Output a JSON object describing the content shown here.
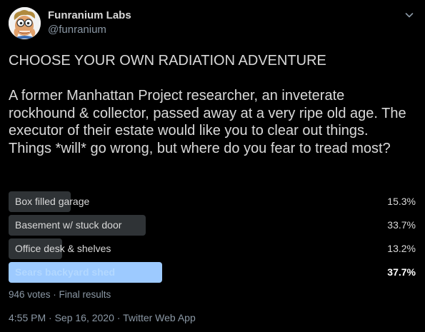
{
  "author": {
    "display_name": "Funranium Labs",
    "handle": "@funranium",
    "avatar_icon": "cartoon-scientist-avatar"
  },
  "tweet": {
    "text": "CHOOSE YOUR OWN RADIATION ADVENTURE\n\nA former Manhattan Project researcher, an inveterate rockhound & collector, passed away at a very ripe old age. The executor of their estate would like you to clear out things. Things *will* go wrong, but where do you fear to tread most?"
  },
  "poll": {
    "options": [
      {
        "label": "Box filled garage",
        "percent": "15.3%",
        "value": 15.3,
        "winner": false
      },
      {
        "label": "Basement w/ stuck door",
        "percent": "33.7%",
        "value": 33.7,
        "winner": false
      },
      {
        "label": "Office desk & shelves",
        "percent": "13.2%",
        "value": 13.2,
        "winner": false
      },
      {
        "label": "Sears backyard shed",
        "percent": "37.7%",
        "value": 37.7,
        "winner": true
      }
    ],
    "summary": "946 votes · Final results"
  },
  "footer": {
    "timestamp": "4:55 PM · Sep 16, 2020 · Twitter Web App"
  },
  "colors": {
    "background": "#000000",
    "bar": "#2f3336",
    "winner_bar": "#9dcaff",
    "secondary_text": "#8b98a5"
  }
}
